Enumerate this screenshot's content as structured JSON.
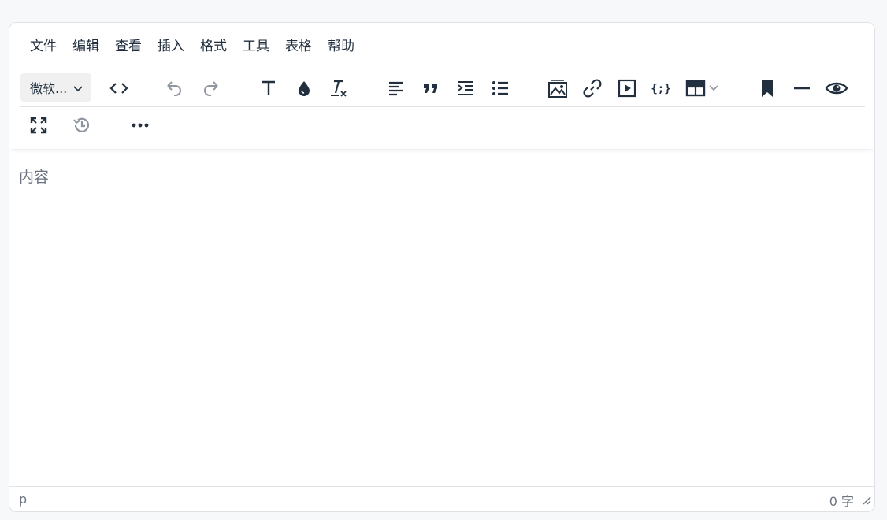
{
  "menubar": {
    "items": [
      "文件",
      "编辑",
      "查看",
      "插入",
      "格式",
      "工具",
      "表格",
      "帮助"
    ]
  },
  "toolbar": {
    "font_family": "微软...",
    "icons": [
      "source-code",
      "undo",
      "redo",
      "text-format",
      "text-color",
      "clear-format",
      "align-left",
      "blockquote",
      "indent",
      "bullet-list",
      "image",
      "link",
      "media",
      "code-sample",
      "table",
      "bookmark",
      "horizontal-rule",
      "preview",
      "fullscreen",
      "history",
      "more"
    ]
  },
  "content": {
    "placeholder": "内容"
  },
  "statusbar": {
    "path": "p",
    "word_count": "0 字"
  },
  "colors": {
    "icon": "#222f3e",
    "icon_disabled": "#8f96a0",
    "border": "#dfe1e5",
    "placeholder": "#6b7280"
  }
}
